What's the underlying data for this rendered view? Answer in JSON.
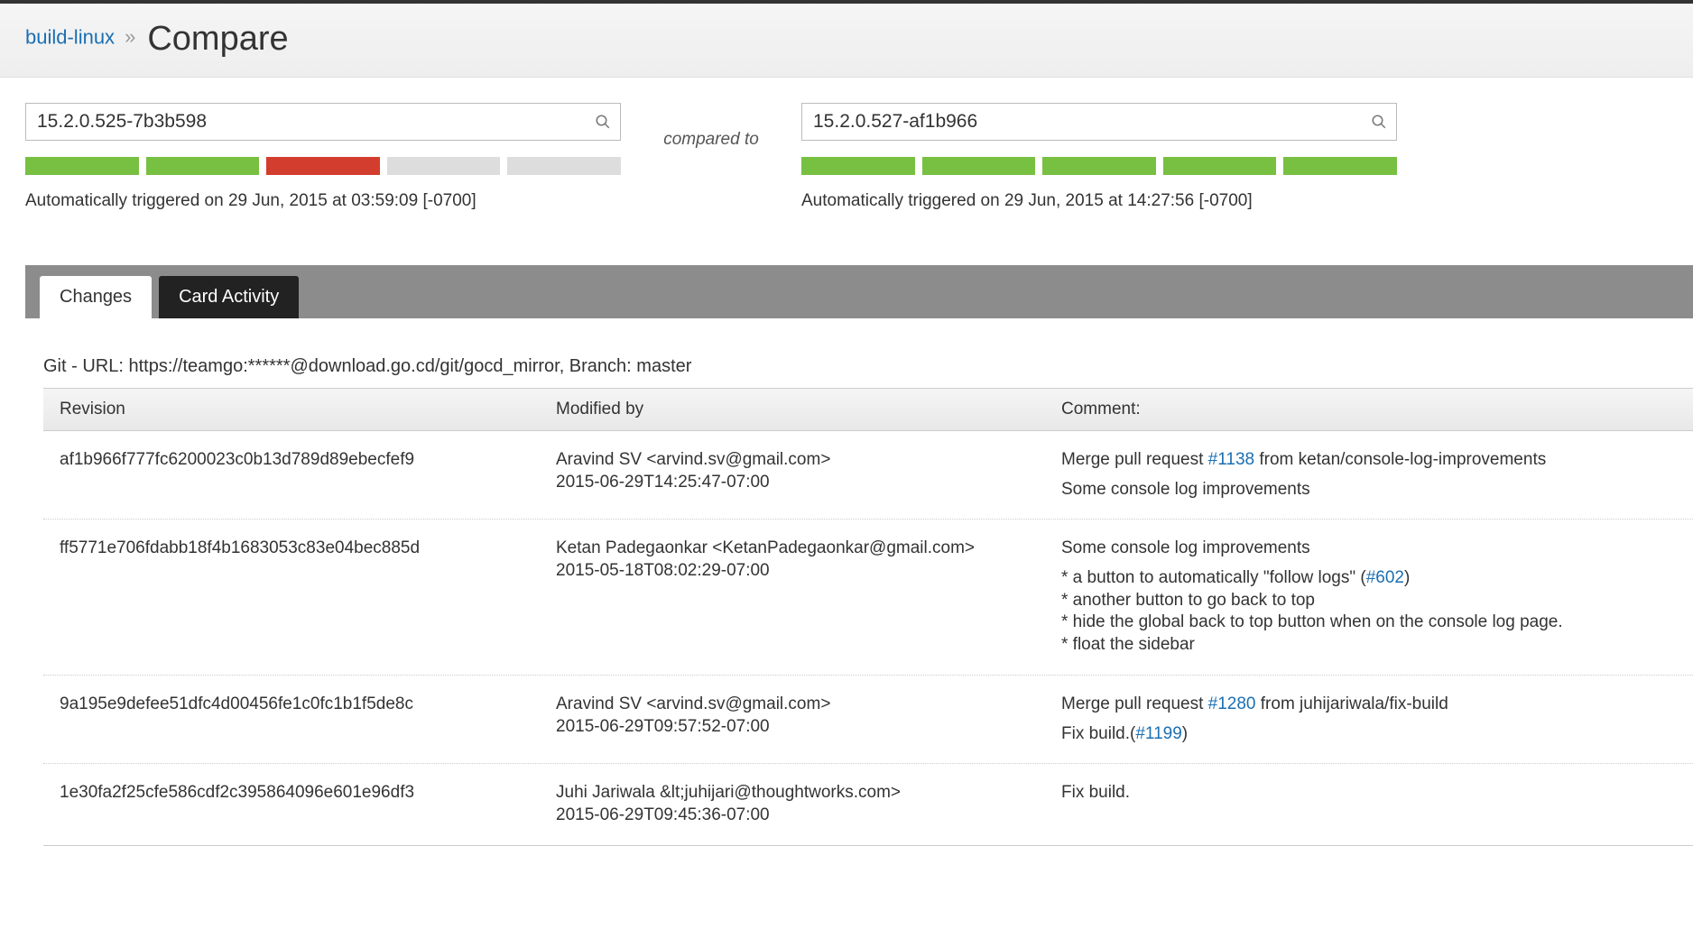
{
  "breadcrumb": {
    "link_text": "build-linux",
    "separator": "»",
    "title": "Compare"
  },
  "compared_to_label": "compared to",
  "left": {
    "value": "15.2.0.525-7b3b598",
    "stages": [
      "green",
      "green",
      "red",
      "gray",
      "gray"
    ],
    "trigger": "Automatically triggered on 29 Jun, 2015 at 03:59:09 [-0700]"
  },
  "right": {
    "value": "15.2.0.527-af1b966",
    "stages": [
      "green",
      "green",
      "green",
      "green",
      "green"
    ],
    "trigger": "Automatically triggered on 29 Jun, 2015 at 14:27:56 [-0700]"
  },
  "tabs": {
    "changes": "Changes",
    "card_activity": "Card Activity"
  },
  "repo": "Git - URL: https://teamgo:******@download.go.cd/git/gocd_mirror, Branch: master",
  "columns": {
    "revision": "Revision",
    "modified_by": "Modified by",
    "comment": "Comment:"
  },
  "rows": [
    {
      "revision": "af1b966f777fc6200023c0b13d789d89ebecfef9",
      "author": "Aravind SV <arvind.sv@gmail.com>",
      "date": "2015-06-29T14:25:47-07:00",
      "comment": [
        {
          "t": "text",
          "v": "Merge pull request "
        },
        {
          "t": "link",
          "v": "#1138"
        },
        {
          "t": "text",
          "v": " from ketan/console-log-improvements"
        },
        {
          "t": "br"
        },
        {
          "t": "text",
          "v": "Some console log improvements"
        }
      ]
    },
    {
      "revision": "ff5771e706fdabb18f4b1683053c83e04bec885d",
      "author": "Ketan Padegaonkar <KetanPadegaonkar@gmail.com>",
      "date": "2015-05-18T08:02:29-07:00",
      "comment": [
        {
          "t": "text",
          "v": "Some console log improvements"
        },
        {
          "t": "br"
        },
        {
          "t": "text",
          "v": "* a button to automatically \"follow logs\" ("
        },
        {
          "t": "link",
          "v": "#602"
        },
        {
          "t": "text",
          "v": ")"
        },
        {
          "t": "nl"
        },
        {
          "t": "text",
          "v": "* another button to go back to top"
        },
        {
          "t": "nl"
        },
        {
          "t": "text",
          "v": "* hide the global back to top button when on the console log page."
        },
        {
          "t": "nl"
        },
        {
          "t": "text",
          "v": "* float the sidebar"
        }
      ]
    },
    {
      "revision": "9a195e9defee51dfc4d00456fe1c0fc1b1f5de8c",
      "author": "Aravind SV <arvind.sv@gmail.com>",
      "date": "2015-06-29T09:57:52-07:00",
      "comment": [
        {
          "t": "text",
          "v": "Merge pull request "
        },
        {
          "t": "link",
          "v": "#1280"
        },
        {
          "t": "text",
          "v": " from juhijariwala/fix-build"
        },
        {
          "t": "br"
        },
        {
          "t": "text",
          "v": "Fix build.("
        },
        {
          "t": "link",
          "v": "#1199"
        },
        {
          "t": "text",
          "v": ")"
        }
      ]
    },
    {
      "revision": "1e30fa2f25cfe586cdf2c395864096e601e96df3",
      "author": "Juhi Jariwala &lt;juhijari@thoughtworks.com>",
      "date": "2015-06-29T09:45:36-07:00",
      "comment": [
        {
          "t": "text",
          "v": "Fix build."
        }
      ]
    }
  ]
}
